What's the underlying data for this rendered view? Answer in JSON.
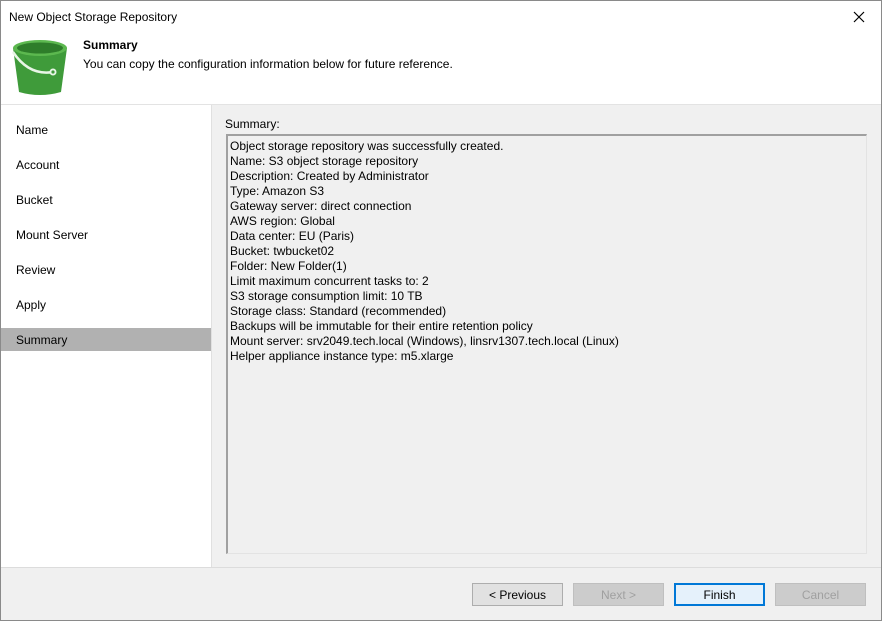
{
  "window": {
    "title": "New Object Storage Repository"
  },
  "header": {
    "title": "Summary",
    "subtitle": "You can copy the configuration information below for future reference.",
    "icon": "bucket-icon",
    "icon_color": "#3f9b3a"
  },
  "sidebar": {
    "items": [
      {
        "label": "Name",
        "active": false
      },
      {
        "label": "Account",
        "active": false
      },
      {
        "label": "Bucket",
        "active": false
      },
      {
        "label": "Mount Server",
        "active": false
      },
      {
        "label": "Review",
        "active": false
      },
      {
        "label": "Apply",
        "active": false
      },
      {
        "label": "Summary",
        "active": true
      }
    ]
  },
  "content": {
    "summary_label": "Summary:",
    "summary_lines": [
      "Object storage repository was successfully created.",
      "Name: S3 object storage repository",
      "Description: Created by Administrator",
      "Type: Amazon S3",
      "Gateway server: direct connection",
      "AWS region: Global",
      "Data center: EU (Paris)",
      "Bucket: twbucket02",
      "Folder: New Folder(1)",
      "Limit maximum concurrent tasks to: 2",
      "S3 storage consumption limit: 10 TB",
      "Storage class: Standard (recommended)",
      "Backups will be immutable for their entire retention policy",
      "Mount server: srv2049.tech.local (Windows), linsrv1307.tech.local (Linux)",
      "Helper appliance instance type: m5.xlarge"
    ]
  },
  "footer": {
    "previous_label": "< Previous",
    "next_label": "Next >",
    "finish_label": "Finish",
    "cancel_label": "Cancel"
  }
}
